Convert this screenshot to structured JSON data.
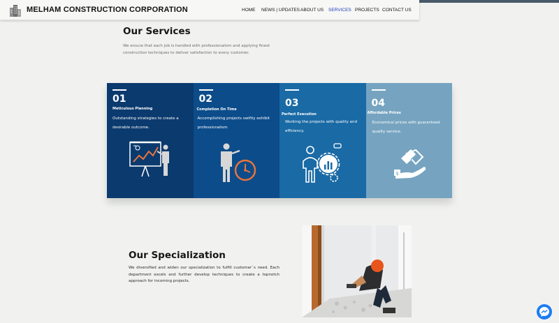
{
  "header": {
    "brand": "MELHAM CONSTRUCTION CORPORATION",
    "nav": [
      {
        "label": "HOME",
        "active": false
      },
      {
        "label": "NEWS | UPDATES",
        "active": false
      },
      {
        "label": "ABOUT US",
        "active": false
      },
      {
        "label": "SERVICES",
        "active": true
      },
      {
        "label": "PROJECTS",
        "active": false
      },
      {
        "label": "CONTACT US",
        "active": false
      }
    ]
  },
  "services": {
    "heading": "Our Services",
    "description": "We ensure that each job is handled with professionalism and applying finest construction techniques to deliver satisfaction to every customer."
  },
  "cards": [
    {
      "number": "01",
      "title": "Meticulous Planning",
      "description": "Outstanding strategies to create a desirable outcome.",
      "color": "#0b3a6e",
      "icon": "presentation-chart-icon"
    },
    {
      "number": "02",
      "title": "Completion On Time",
      "description": "Accomplishing projects swiftly exhibit professionalism",
      "color": "#0c4c8a",
      "icon": "businessman-clock-icon"
    },
    {
      "number": "03",
      "title": "Perfect Execution",
      "description": "Working the projects with quality and efficiency.",
      "color": "#1a6aa5",
      "icon": "analyst-gear-chart-icon"
    },
    {
      "number": "04",
      "title": "Affordable Prices",
      "description": "Economical prices with guaranteed quality service.",
      "color": "#76a4c0",
      "icon": "handshake-money-icon"
    }
  ],
  "specialization": {
    "heading": "Our Specialization",
    "description": "We diversified and widen our specialization to fulfill customer`s need. Each department excels and further develop techniques to create a topnotch approach for incoming projects."
  },
  "accent_color": "#1a3fb8",
  "messenger_icon": "messenger-icon"
}
